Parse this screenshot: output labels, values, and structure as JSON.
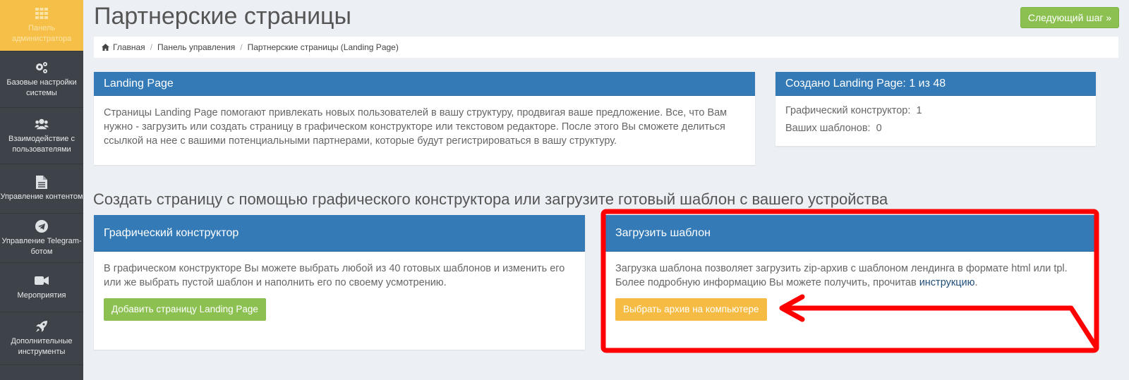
{
  "sidebar": {
    "items": [
      {
        "label": "Панель администратора",
        "icon": "grid-icon"
      },
      {
        "label": "Базовые настройки системы",
        "icon": "gears-icon"
      },
      {
        "label": "Взаимодействие с пользователями",
        "icon": "users-icon"
      },
      {
        "label": "Управление контентом",
        "icon": "document-icon"
      },
      {
        "label": "Управление Telegram-ботом",
        "icon": "telegram-icon"
      },
      {
        "label": "Мероприятия",
        "icon": "video-camera-icon"
      },
      {
        "label": "Дополнительные инструменты",
        "icon": "rocket-icon"
      }
    ]
  },
  "header": {
    "title": "Партнерские страницы",
    "next_button": "Следующий шаг »"
  },
  "breadcrumb": {
    "home": "Главная",
    "panel": "Панель управления",
    "current": "Партнерские страницы (Landing Page)"
  },
  "landing_panel": {
    "title": "Landing Page",
    "text": "Страницы Landing Page помогают привлекать новых пользователей в вашу структуру, продвигая ваше предложение. Все, что Вам нужно - загрузить или создать страницу в графическом конструкторе или текстовом редакторе. После этого Вы сможете делиться ссылкой на нее с вашими потенциальными партнерами, которые будут регистрироваться в вашу структуру."
  },
  "stats_panel": {
    "title": "Создано Landing Page: 1 из 48",
    "rows": [
      {
        "label": "Графический конструктор:",
        "value": "1"
      },
      {
        "label": "Ваших шаблонов:",
        "value": "0"
      }
    ]
  },
  "section_title": "Создать страницу с помощью графического конструктора или загрузите готовый шаблон с вашего устройства",
  "constructor_panel": {
    "title": "Графический конструктор",
    "text": "В графическом конструкторе Вы можете выбрать любой из 40 готовых шаблонов и изменить его или же выбрать пустой шаблон и наполнить его по своему усмотрению.",
    "button": "Добавить страницу Landing Page"
  },
  "upload_panel": {
    "title": "Загрузить шаблон",
    "text_before": "Загрузка шаблона позволяет загрузить zip-архив с шаблоном лендинга в формате html или tpl. Более подробную информацию Вы можете получить, прочитав ",
    "link": "инструкцию",
    "text_after": ".",
    "button": "Выбрать архив на компьютере"
  },
  "colors": {
    "primary": "#337ab7",
    "success": "#8cc152",
    "warning": "#f6bb42",
    "sidebar": "#3d4349",
    "annotation": "#ff0000"
  }
}
